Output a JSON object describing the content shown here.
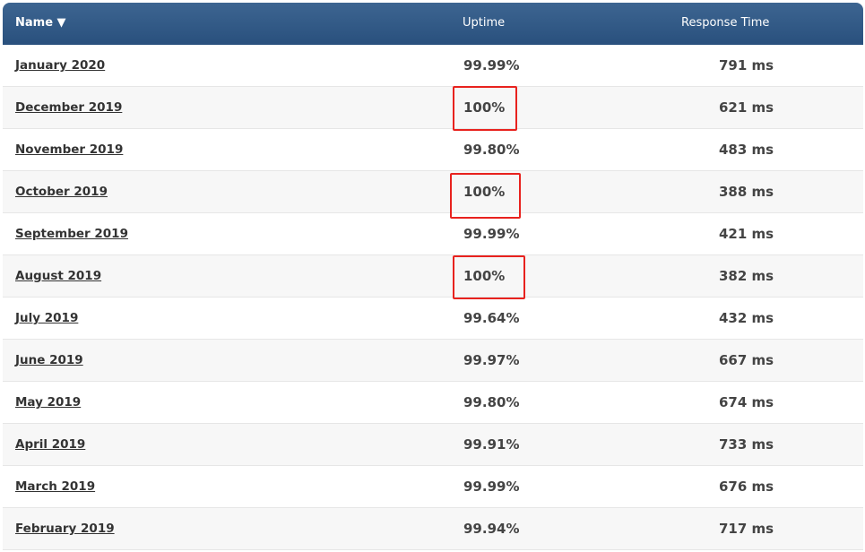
{
  "table": {
    "columns": {
      "name": "Name",
      "sort_indicator": "▼",
      "uptime": "Uptime",
      "response_time": "Response Time"
    },
    "rows": [
      {
        "name": "January 2020",
        "uptime": "99.99%",
        "response_time": "791 ms",
        "highlighted": false
      },
      {
        "name": "December 2019",
        "uptime": "100%",
        "response_time": "621 ms",
        "highlighted": true
      },
      {
        "name": "November 2019",
        "uptime": "99.80%",
        "response_time": "483 ms",
        "highlighted": false
      },
      {
        "name": "October 2019",
        "uptime": "100%",
        "response_time": "388 ms",
        "highlighted": true
      },
      {
        "name": "September 2019",
        "uptime": "99.99%",
        "response_time": "421 ms",
        "highlighted": false
      },
      {
        "name": "August 2019",
        "uptime": "100%",
        "response_time": "382 ms",
        "highlighted": true
      },
      {
        "name": "July 2019",
        "uptime": "99.64%",
        "response_time": "432 ms",
        "highlighted": false
      },
      {
        "name": "June 2019",
        "uptime": "99.97%",
        "response_time": "667 ms",
        "highlighted": false
      },
      {
        "name": "May 2019",
        "uptime": "99.80%",
        "response_time": "674 ms",
        "highlighted": false
      },
      {
        "name": "April 2019",
        "uptime": "99.91%",
        "response_time": "733 ms",
        "highlighted": false
      },
      {
        "name": "March 2019",
        "uptime": "99.99%",
        "response_time": "676 ms",
        "highlighted": false
      },
      {
        "name": "February 2019",
        "uptime": "99.94%",
        "response_time": "717 ms",
        "highlighted": false
      }
    ]
  },
  "colors": {
    "header_top": "#3d6591",
    "header_bottom": "#29507d",
    "highlight_border": "#e8221e",
    "alt_row": "#f7f7f7"
  }
}
